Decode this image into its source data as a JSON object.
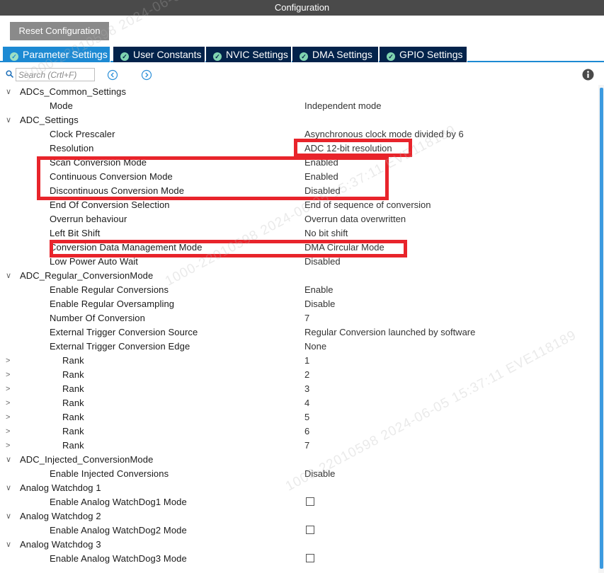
{
  "window": {
    "title": "Configuration"
  },
  "reset_button": {
    "label": "Reset Configuration"
  },
  "tabs": [
    {
      "label": "Parameter Settings",
      "active": true
    },
    {
      "label": "User Constants",
      "active": false
    },
    {
      "label": "NVIC Settings",
      "active": false
    },
    {
      "label": "DMA Settings",
      "active": false
    },
    {
      "label": "GPIO Settings",
      "active": false
    }
  ],
  "search": {
    "placeholder": "Search (Crtl+F)"
  },
  "tree": {
    "adcs_common": {
      "title": "ADCs_Common_Settings",
      "mode_label": "Mode",
      "mode_value": "Independent mode"
    },
    "adc_settings": {
      "title": "ADC_Settings",
      "clock_prescaler_label": "Clock Prescaler",
      "clock_prescaler_value": "Asynchronous clock mode divided by 6",
      "resolution_label": "Resolution",
      "resolution_value": "ADC 12-bit resolution",
      "scan_label": "Scan Conversion Mode",
      "scan_value": "Enabled",
      "continuous_label": "Continuous Conversion Mode",
      "continuous_value": "Enabled",
      "discontinuous_label": "Discontinuous Conversion Mode",
      "discontinuous_value": "Disabled",
      "eoc_label": "End Of Conversion Selection",
      "eoc_value": "End of sequence of conversion",
      "overrun_label": "Overrun behaviour",
      "overrun_value": "Overrun data overwritten",
      "left_shift_label": "Left Bit Shift",
      "left_shift_value": "No bit shift",
      "data_mgmt_label": "Conversion Data Management Mode",
      "data_mgmt_value": "DMA Circular Mode",
      "low_power_label": "Low Power Auto Wait",
      "low_power_value": "Disabled"
    },
    "regular": {
      "title": "ADC_Regular_ConversionMode",
      "enable_label": "Enable Regular Conversions",
      "enable_value": "Enable",
      "oversampling_label": "Enable Regular Oversampling",
      "oversampling_value": "Disable",
      "number_label": "Number Of Conversion",
      "number_value": "7",
      "trigger_source_label": "External Trigger Conversion Source",
      "trigger_source_value": "Regular Conversion launched by software",
      "trigger_edge_label": "External Trigger Conversion Edge",
      "trigger_edge_value": "None",
      "ranks": [
        {
          "label": "Rank",
          "value": "1"
        },
        {
          "label": "Rank",
          "value": "2"
        },
        {
          "label": "Rank",
          "value": "3"
        },
        {
          "label": "Rank",
          "value": "4"
        },
        {
          "label": "Rank",
          "value": "5"
        },
        {
          "label": "Rank",
          "value": "6"
        },
        {
          "label": "Rank",
          "value": "7"
        }
      ]
    },
    "injected": {
      "title": "ADC_Injected_ConversionMode",
      "enable_label": "Enable Injected Conversions",
      "enable_value": "Disable"
    },
    "watchdog1": {
      "title": "Analog Watchdog 1",
      "enable_label": "Enable Analog WatchDog1 Mode",
      "checked": false
    },
    "watchdog2": {
      "title": "Analog Watchdog 2",
      "enable_label": "Enable Analog WatchDog2 Mode",
      "checked": false
    },
    "watchdog3": {
      "title": "Analog Watchdog 3",
      "enable_label": "Enable Analog WatchDog3 Mode",
      "checked": false
    }
  },
  "watermark": {
    "text": "1000-22010598 2024-06-05 15:37:11 EVE118189"
  },
  "colors": {
    "titlebar": "#4a4a4a",
    "tab_inactive": "#03234b",
    "tab_active": "#1d8ad3",
    "highlight": "#e8242b",
    "accent": "#1d8ad3"
  }
}
